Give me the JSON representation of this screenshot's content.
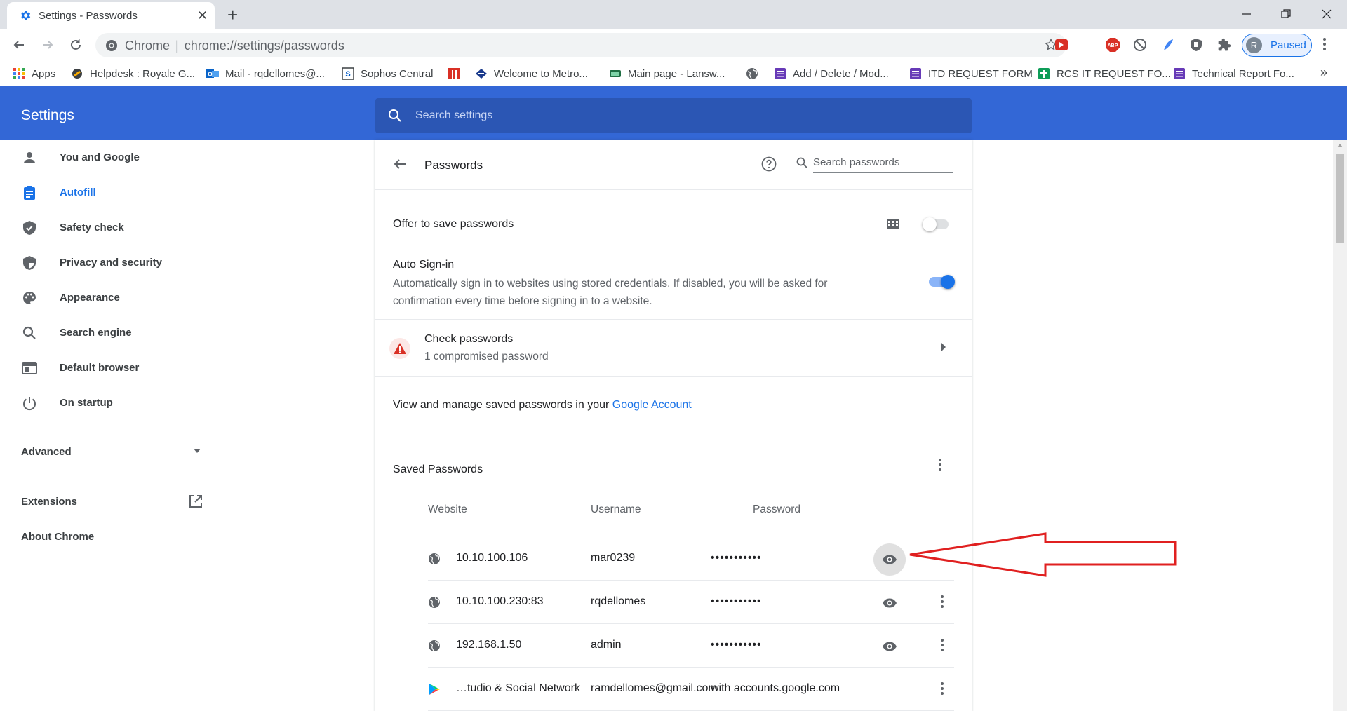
{
  "browser": {
    "tab_title": "Settings - Passwords",
    "omnibox_scheme": "Chrome",
    "omnibox_url": "chrome://settings/passwords",
    "profile_initial": "R",
    "profile_status": "Paused"
  },
  "bookmarks": [
    {
      "label": "Apps",
      "icon": "apps-grid-icon"
    },
    {
      "label": "Helpdesk : Royale G...",
      "icon": "helpdesk-icon"
    },
    {
      "label": "Mail - rqdellomes@...",
      "icon": "outlook-icon"
    },
    {
      "label": "Sophos Central",
      "icon": "sophos-icon"
    },
    {
      "label": "",
      "icon": "red-bar-icon"
    },
    {
      "label": "Welcome to Metro...",
      "icon": "metro-icon"
    },
    {
      "label": "Main page - Lansw...",
      "icon": "lansweeper-icon"
    },
    {
      "label": "",
      "icon": "globe-icon"
    },
    {
      "label": "Add / Delete / Mod...",
      "icon": "form-icon"
    },
    {
      "label": "ITD REQUEST FORM",
      "icon": "form-icon"
    },
    {
      "label": "RCS IT REQUEST FO...",
      "icon": "sheets-icon"
    },
    {
      "label": "Technical Report Fo...",
      "icon": "form-icon"
    }
  ],
  "settings": {
    "title": "Settings",
    "search_placeholder": "Search settings"
  },
  "sidebar": {
    "items": [
      {
        "label": "You and Google",
        "icon": "person-icon",
        "active": false
      },
      {
        "label": "Autofill",
        "icon": "clipboard-icon",
        "active": true
      },
      {
        "label": "Safety check",
        "icon": "shield-check-icon",
        "active": false
      },
      {
        "label": "Privacy and security",
        "icon": "shield-icon",
        "active": false
      },
      {
        "label": "Appearance",
        "icon": "palette-icon",
        "active": false
      },
      {
        "label": "Search engine",
        "icon": "search-icon",
        "active": false
      },
      {
        "label": "Default browser",
        "icon": "browser-icon",
        "active": false
      },
      {
        "label": "On startup",
        "icon": "power-icon",
        "active": false
      }
    ],
    "advanced": "Advanced",
    "extensions": "Extensions",
    "about": "About Chrome"
  },
  "passwords": {
    "title": "Passwords",
    "search_placeholder": "Search passwords",
    "offer_label": "Offer to save passwords",
    "offer_enabled": false,
    "autosign_title": "Auto Sign-in",
    "autosign_desc": "Automatically sign in to websites using stored credentials. If disabled, you will be asked for confirmation every time before signing in to a website.",
    "autosign_enabled": true,
    "check_title": "Check passwords",
    "check_sub": "1 compromised password",
    "manage_prefix": "View and manage saved passwords in your ",
    "manage_link": "Google Account",
    "saved_title": "Saved Passwords",
    "columns": {
      "website": "Website",
      "username": "Username",
      "password": "Password"
    },
    "rows": [
      {
        "site": "10.10.100.106",
        "user": "mar0239",
        "pass": "•••••••••••",
        "icon": "globe-icon"
      },
      {
        "site": "10.10.100.230:83",
        "user": "rqdellomes",
        "pass": "•••••••••••",
        "icon": "globe-icon"
      },
      {
        "site": "192.168.1.50",
        "user": "admin",
        "pass": "•••••••••••",
        "icon": "globe-icon"
      },
      {
        "site": "…tudio & Social Network",
        "user": "ramdellomes@gmail.com",
        "pass": "with accounts.google.com",
        "icon": "play-store-icon"
      }
    ]
  },
  "colors": {
    "header_blue": "#3367d6",
    "accent": "#1a73e8",
    "annotation_red": "#e02020"
  }
}
